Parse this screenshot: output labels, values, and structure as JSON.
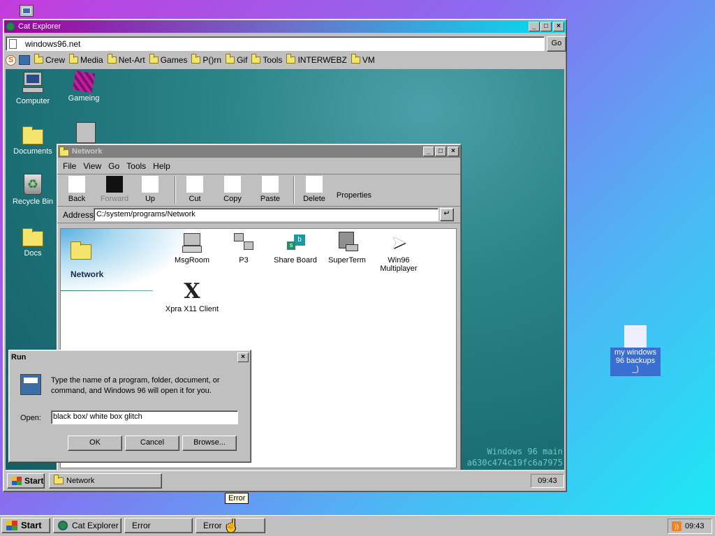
{
  "browser": {
    "title": "Cat Explorer",
    "url": "windows96.net",
    "go_label": "Go",
    "bookmarks": [
      "Crew",
      "Media",
      "Net-Art",
      "Games",
      "P()rn",
      "Gif",
      "Tools",
      "INTERWEBZ",
      "VM"
    ]
  },
  "desktop_icons": [
    "Computer",
    "Gameing",
    "Documents",
    "Recycle Bin",
    "Docs"
  ],
  "network_window": {
    "title": "Network",
    "menu": [
      "File",
      "View",
      "Go",
      "Tools",
      "Help"
    ],
    "toolbar": [
      "Back",
      "Forward",
      "Up",
      "Cut",
      "Copy",
      "Paste",
      "Delete",
      "Properties"
    ],
    "address_label": "Address",
    "address": "C:/system/programs/Network",
    "side_title": "Network",
    "items": [
      "MsgRoom",
      "P3",
      "Share Board",
      "SuperTerm",
      "Win96 Multiplayer",
      "Xpra X11 Client"
    ]
  },
  "run_dialog": {
    "title": "Run",
    "message": "Type the name of a program, folder, document, or command, and Windows 96 will open it for you.",
    "open_label": "Open:",
    "value": "black box/ white box glitch",
    "ok": "OK",
    "cancel": "Cancel",
    "browse": "Browse..."
  },
  "watermark": {
    "line1": "Windows 96 main",
    "line2": "a630c474c19fc6a7975"
  },
  "inner_taskbar": {
    "start": "Start",
    "task": "Network",
    "clock": "09:43"
  },
  "desktop_file": {
    "label": "my windows 96 backups _)"
  },
  "tooltip": "Error",
  "taskbar": {
    "start": "Start",
    "tasks": [
      "Cat Explorer",
      "Error",
      "Error"
    ],
    "clock": "09:43"
  }
}
